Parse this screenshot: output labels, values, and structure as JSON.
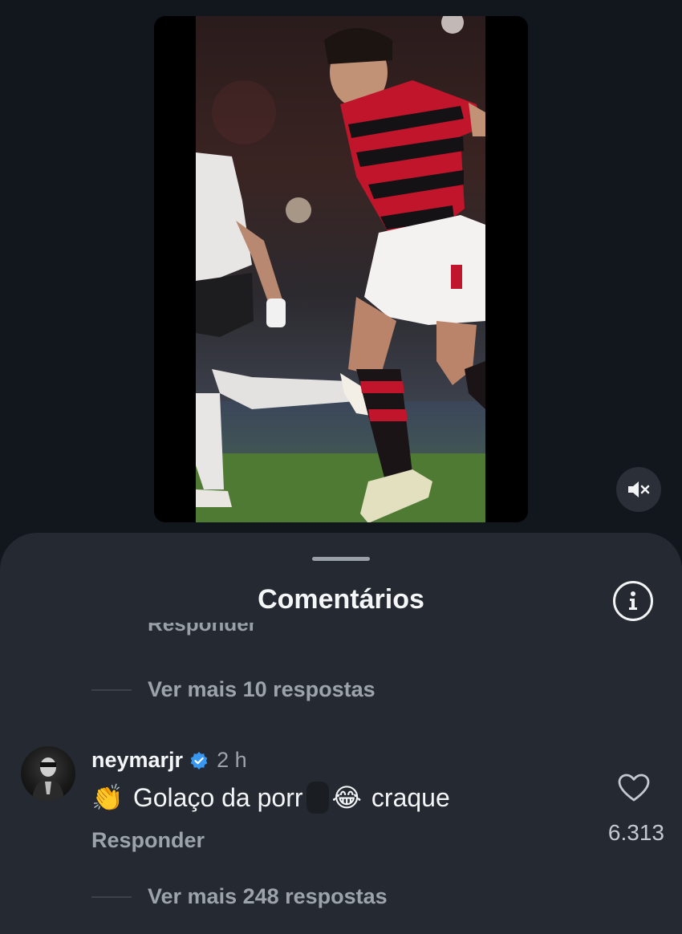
{
  "sheet": {
    "title": "Comentários",
    "cut_text": "Responder"
  },
  "replies_above": {
    "label": "Ver mais 10 respostas"
  },
  "comment": {
    "username": "neymarjr",
    "time": "2 h",
    "emoji_clap": "👏",
    "text_part1": "Golaço da porr",
    "emoji_laugh": "😂",
    "text_part2": "craque",
    "reply_label": "Responder",
    "like_count": "6.313"
  },
  "replies_below": {
    "label": "Ver mais 248 respostas"
  },
  "icons": {
    "mute": "speaker-muted-icon",
    "info": "info-icon",
    "like": "heart-icon",
    "verified": "verified-badge-icon"
  },
  "colors": {
    "background": "#12161d",
    "sheet": "#252a32",
    "verified": "#3897f0",
    "jersey_red": "#c0152a"
  }
}
